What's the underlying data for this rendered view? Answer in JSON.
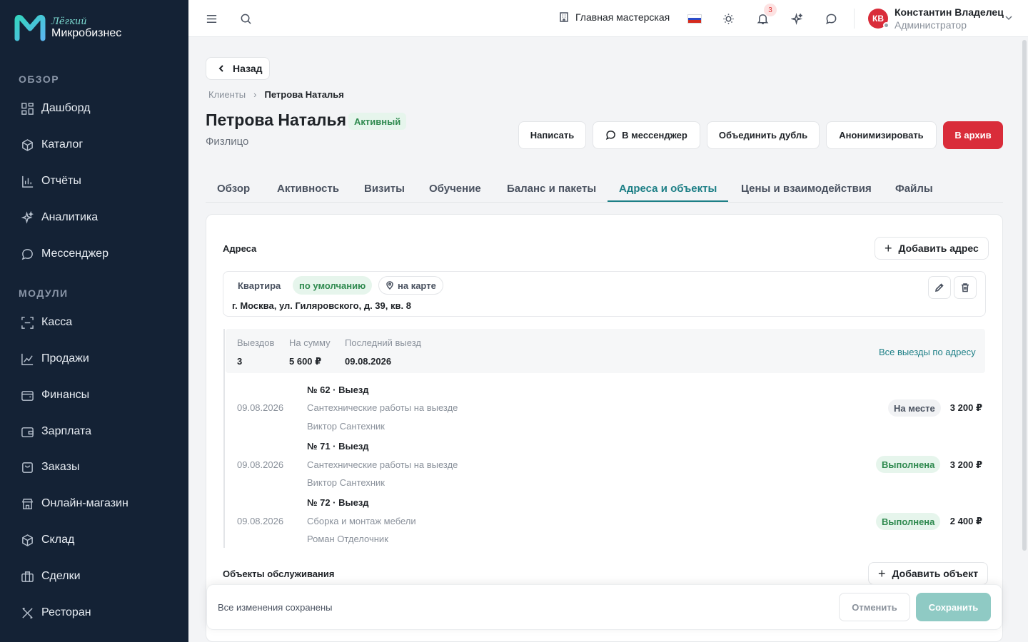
{
  "brand": {
    "line1": "Лёгкий",
    "line2": "Микробизнес"
  },
  "sidebar": {
    "section_overview": "ОБЗОР",
    "section_modules": "МОДУЛИ",
    "items": [
      {
        "label": "Дашборд",
        "icon": "dashboard-icon"
      },
      {
        "label": "Каталог",
        "icon": "catalog-icon"
      },
      {
        "label": "Отчёты",
        "icon": "reports-icon"
      },
      {
        "label": "Аналитика",
        "icon": "sparkle-icon"
      },
      {
        "label": "Мессенджер",
        "icon": "chat-icon"
      },
      {
        "label": "Касса",
        "icon": "scan-icon"
      },
      {
        "label": "Продажи",
        "icon": "chart-line-icon"
      },
      {
        "label": "Финансы",
        "icon": "wallet-icon"
      },
      {
        "label": "Зарплата",
        "icon": "wallet-icon"
      },
      {
        "label": "Заказы",
        "icon": "orders-icon"
      },
      {
        "label": "Онлайн-магазин",
        "icon": "store-icon"
      },
      {
        "label": "Склад",
        "icon": "box-icon"
      },
      {
        "label": "Сделки",
        "icon": "briefcase-icon"
      },
      {
        "label": "Ресторан",
        "icon": "cutlery-icon"
      }
    ]
  },
  "topbar": {
    "workshop": "Главная мастерская",
    "notifications_count": "3",
    "user_initials": "КВ",
    "user_name": "Константин Владелец",
    "user_role": "Администратор"
  },
  "page": {
    "back_label": "Назад",
    "breadcrumb_root": "Клиенты",
    "breadcrumb_current": "Петрова Наталья",
    "title": "Петрова Наталья",
    "status": "Активный",
    "subtitle": "Физлицо",
    "actions": {
      "write": "Написать",
      "messenger": "В мессенджер",
      "merge": "Объединить дубль",
      "anonymize": "Анонимизировать",
      "archive": "В архив"
    },
    "tabs": [
      "Обзор",
      "Активность",
      "Визиты",
      "Обучение",
      "Баланс и пакеты",
      "Адреса и объекты",
      "Цены и взаимодействия",
      "Файлы"
    ],
    "active_tab": "Адреса и объекты"
  },
  "addresses": {
    "title": "Адреса",
    "add_label": "Добавить адрес",
    "item": {
      "type": "Квартира",
      "default_badge": "по умолчанию",
      "map_label": "на карте",
      "address": "г. Москва, ул. Гиляровского, д. 39, кв. 8"
    },
    "stats": {
      "trips_label": "Выездов",
      "trips_value": "3",
      "sum_label": "На сумму",
      "sum_value": "5 600 ₽",
      "last_label": "Последний выезд",
      "last_value": "09.08.2026",
      "all_link": "Все выезды по адресу"
    },
    "visits": [
      {
        "date": "09.08.2026",
        "title": "№ 62 · Выезд",
        "desc": "Сантехнические работы на выезде",
        "tech": "Виктор Сантехник",
        "status": "На месте",
        "status_kind": "onsite",
        "amount": "3 200 ₽"
      },
      {
        "date": "09.08.2026",
        "title": "№ 71 · Выезд",
        "desc": "Сантехнические работы на выезде",
        "tech": "Виктор Сантехник",
        "status": "Выполнена",
        "status_kind": "done",
        "amount": "3 200 ₽"
      },
      {
        "date": "09.08.2026",
        "title": "№ 72 · Выезд",
        "desc": "Сборка и монтаж мебели",
        "tech": "Роман Отделочник",
        "status": "Выполнена",
        "status_kind": "done",
        "amount": "2 400 ₽"
      }
    ]
  },
  "objects": {
    "title": "Объекты обслуживания",
    "add_label": "Добавить объект"
  },
  "savebar": {
    "message": "Все изменения сохранены",
    "cancel": "Отменить",
    "save": "Сохранить"
  },
  "colors": {
    "sidebar_bg": "#142235",
    "accent": "#1d7f86",
    "danger": "#d92c3a",
    "success_bg": "#e6f5ec",
    "success_text": "#2f8a4f"
  }
}
